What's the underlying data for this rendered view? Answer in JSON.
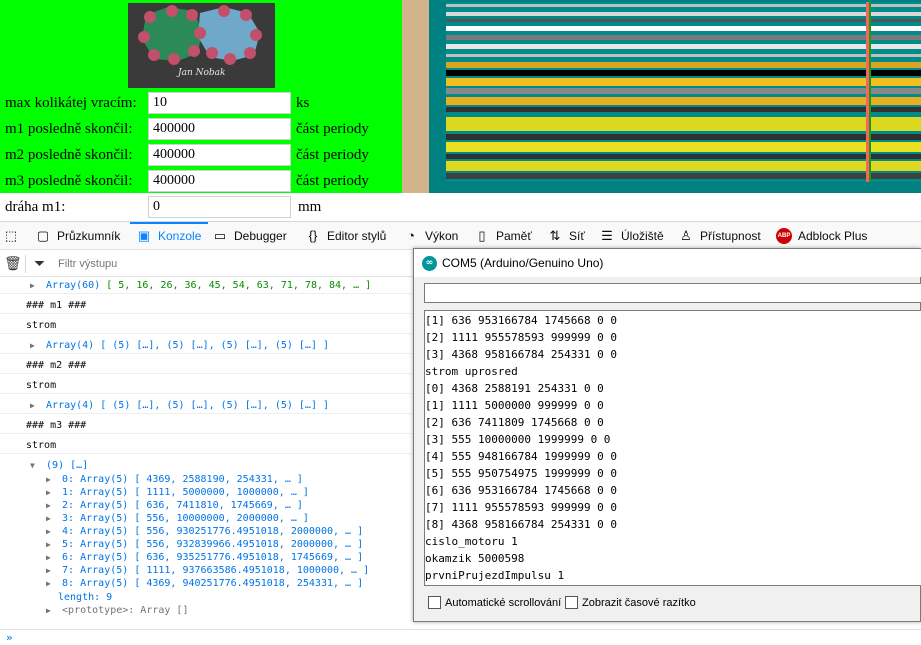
{
  "page": {
    "photo_signature": "Jan Nobak",
    "rows": [
      {
        "label": "max kolikátej vracím:",
        "value": "10",
        "unit": "ks"
      },
      {
        "label": "m1 posledně skončil:",
        "value": "400000",
        "unit": "část periody"
      },
      {
        "label": "m2 posledně skončil:",
        "value": "400000",
        "unit": "část periody"
      },
      {
        "label": "m3 posledně skončil:",
        "value": "400000",
        "unit": "část periody"
      },
      {
        "label": "dráha m1:",
        "value": "0",
        "unit": "mm"
      }
    ],
    "colors": {
      "green": "#00ff00",
      "tan": "#d2b48c",
      "teal": "#008080"
    }
  },
  "devtools": {
    "tabs": [
      {
        "label": "",
        "icon": "pick-element-icon"
      },
      {
        "label": "Průzkumník",
        "icon": "inspector-icon"
      },
      {
        "label": "Konzole",
        "icon": "console-icon",
        "selected": true
      },
      {
        "label": "Debugger",
        "icon": "debugger-icon"
      },
      {
        "label": "Editor stylů",
        "icon": "style-editor-icon"
      },
      {
        "label": "Výkon",
        "icon": "performance-icon"
      },
      {
        "label": "Paměť",
        "icon": "memory-icon"
      },
      {
        "label": "Síť",
        "icon": "network-icon"
      },
      {
        "label": "Úložiště",
        "icon": "storage-icon"
      },
      {
        "label": "Přístupnost",
        "icon": "accessibility-icon"
      },
      {
        "label": "Adblock Plus",
        "icon": "adblock-icon"
      }
    ],
    "filter_placeholder": "Filtr výstupu",
    "adblock_badge": "ABP",
    "accent_color": "#0a84ff"
  },
  "console": {
    "lines": [
      {
        "kind": "array",
        "head": "Array(60)",
        "body": "[ 5, 16, 26, 36, 45, 54, 63, 71, 78, 84, … ]"
      },
      {
        "kind": "text",
        "text": "### m1 ###"
      },
      {
        "kind": "text",
        "text": "strom"
      },
      {
        "kind": "array",
        "head": "Array(4)",
        "body": "[ (5) […], (5) […], (5) […], (5) […] ]"
      },
      {
        "kind": "text",
        "text": "### m2 ###"
      },
      {
        "kind": "text",
        "text": "strom"
      },
      {
        "kind": "array",
        "head": "Array(4)",
        "body": "[ (5) […], (5) […], (5) […], (5) […] ]"
      },
      {
        "kind": "text",
        "text": "### m3 ###"
      },
      {
        "kind": "text",
        "text": "strom"
      }
    ],
    "expanded_head": "(9) […]",
    "expanded_items": [
      {
        "key": "0:",
        "head": "Array(5)",
        "body": "[ 4369, 2588190, 254331, … ]"
      },
      {
        "key": "1:",
        "head": "Array(5)",
        "body": "[ 1111, 5000000, 1000000, … ]"
      },
      {
        "key": "2:",
        "head": "Array(5)",
        "body": "[ 636, 7411810, 1745669, … ]"
      },
      {
        "key": "3:",
        "head": "Array(5)",
        "body": "[ 556, 10000000, 2000000, … ]"
      },
      {
        "key": "4:",
        "head": "Array(5)",
        "body": "[ 556, 930251776.4951018, 2000000, … ]"
      },
      {
        "key": "5:",
        "head": "Array(5)",
        "body": "[ 556, 932839966.4951018, 2000000, … ]"
      },
      {
        "key": "6:",
        "head": "Array(5)",
        "body": "[ 636, 935251776.4951018, 1745669, … ]"
      },
      {
        "key": "7:",
        "head": "Array(5)",
        "body": "[ 1111, 937663586.4951018, 1000000, … ]"
      },
      {
        "key": "8:",
        "head": "Array(5)",
        "body": "[ 4369, 940251776.4951018, 254331, … ]"
      }
    ],
    "length_label": "length: 9",
    "prototype_label": "<prototype>: Array []",
    "prompt": "»"
  },
  "serial_monitor": {
    "title": "COM5 (Arduino/Genuino Uno)",
    "icon": "arduino-icon",
    "lines": [
      "[1] 636 953166784 1745668 0 0",
      "[2] 1111 955578593 999999 0 0",
      "[3] 4368 958166784 254331 0 0",
      "strom uprosred",
      "[0] 4368 2588191 254331 0 0",
      "[1] 1111 5000000 999999 0 0",
      "[2] 636 7411809 1745668 0 0",
      "[3] 555 10000000 1999999 0 0",
      "[4] 555 948166784 1999999 0 0",
      "[5] 555 950754975 1999999 0 0",
      "[6] 636 953166784 1745668 0 0",
      "[7] 1111 955578593 999999 0 0",
      "[8] 4368 958166784 254331 0 0",
      "cislo_motoru 1",
      "okamzik 5000598",
      "prvniPrujezdImpulsu 1"
    ],
    "autoscroll_label": "Automatické scrollování",
    "timestamp_label": "Zobrazit časové razítko"
  }
}
